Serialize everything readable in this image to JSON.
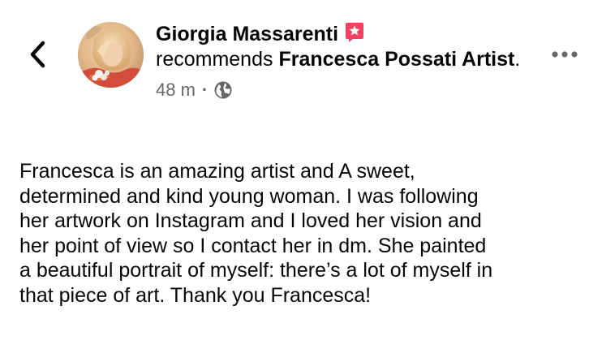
{
  "post": {
    "author": "Giorgia Massarenti",
    "action_verb": "recommends",
    "page_name": "Francesca Possati Artist",
    "page_suffix": ".",
    "timestamp": "48 m",
    "separator": "·",
    "audience_icon": "globe-icon",
    "badge_icon": "recommendation-star-icon",
    "more_icon": "more-horizontal-icon",
    "back_icon": "chevron-left-icon",
    "body_lines": [
      "Francesca is an amazing artist and A sweet,",
      "determined and kind young woman. I was following",
      "her artwork on Instagram and I loved her vision and",
      "her point of view so I contact her in dm. She painted",
      "a beautiful portrait of myself: there’s a lot of myself in",
      "that piece of art. Thank you Francesca!"
    ]
  },
  "colors": {
    "primary_text": "#050505",
    "secondary_text": "#65676b",
    "badge_pink": "#f3425f",
    "background": "#ffffff"
  }
}
